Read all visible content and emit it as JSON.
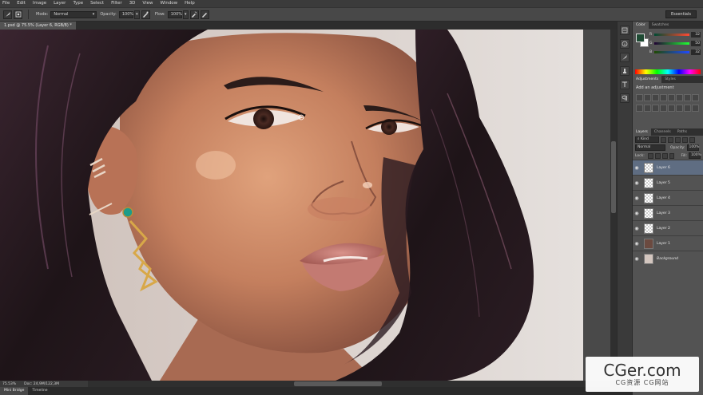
{
  "menu": [
    "File",
    "Edit",
    "Image",
    "Layer",
    "Type",
    "Select",
    "Filter",
    "3D",
    "View",
    "Window",
    "Help"
  ],
  "options": {
    "mode_label": "Mode:",
    "mode_value": "Normal",
    "opacity_label": "Opacity:",
    "opacity_value": "100%",
    "flow_label": "Flow:",
    "flow_value": "100%",
    "workspace": "Essentials"
  },
  "document": {
    "tab_title": "1.psd @ 75.5% (Layer 6, RGB/8) *",
    "zoom": "75.53%",
    "doc_size": "Doc: 24,9M/122,3M"
  },
  "bottom_tabs": [
    "Mini Bridge",
    "Timeline"
  ],
  "color_panel": {
    "tabs": [
      "Color",
      "Swatches"
    ],
    "fg_color": "#1e4a33",
    "bg_color": "#ffffff",
    "channels": [
      {
        "label": "R",
        "value": "32"
      },
      {
        "label": "G",
        "value": "50"
      },
      {
        "label": "B",
        "value": "32"
      }
    ]
  },
  "adjustments_panel": {
    "tabs": [
      "Adjustments",
      "Styles"
    ],
    "title": "Add an adjustment"
  },
  "layers_panel": {
    "tabs": [
      "Layers",
      "Channels",
      "Paths"
    ],
    "kind_label": "Kind",
    "blend_mode": "Normal",
    "opacity_label": "Opacity:",
    "opacity_value": "100%",
    "lock_label": "Lock:",
    "fill_label": "Fill:",
    "fill_value": "100%",
    "layers": [
      {
        "name": "Layer 6",
        "selected": true
      },
      {
        "name": "Layer 5"
      },
      {
        "name": "Layer 4"
      },
      {
        "name": "Layer 3"
      },
      {
        "name": "Layer 2"
      },
      {
        "name": "Layer 1"
      },
      {
        "name": "Background"
      }
    ]
  },
  "watermark": {
    "line1": "CGer.com",
    "line2": "CG资源 CG网站"
  }
}
